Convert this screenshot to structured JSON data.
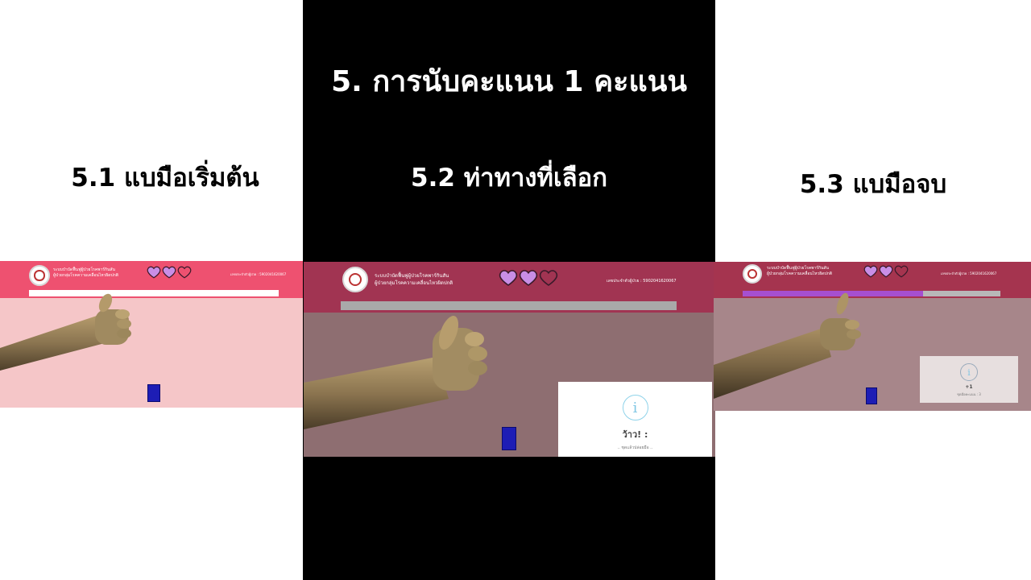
{
  "slide": {
    "title": "5. การนับคะแนน 1 คะแนน",
    "step1_label": "5.1 แบมือเริ่มต้น",
    "step2_label": "5.2 ท่าทางที่เลือก",
    "step3_label": "5.3 แบมือจบ"
  },
  "app": {
    "system_title_line1": "ระบบบำบัดฟื้นฟูผู้ป่วยโรคพาร์กินสัน",
    "system_title_line2": "ผู้ป่วยกลุ่มโรคความเคลื่อนไหวผิดปกติ",
    "patient_id": "เลขประจำตัวผู้ป่วย : 5902041620067",
    "colors": {
      "purple_heart": "#c98ee6",
      "progress": "#a64fd0",
      "target_block": "#1d1db5"
    }
  },
  "screens": {
    "shot1": {
      "hearts_filled": 2,
      "hearts_total": 3,
      "progress": 0.0
    },
    "shot2": {
      "hearts_filled": 2,
      "hearts_total": 3,
      "progress": 0.0,
      "popup": {
        "icon": "info-icon",
        "title": "ว้าว! :",
        "text": ".. ชุดแล้วปล่อยมือ .."
      }
    },
    "shot3": {
      "hearts_filled": 2,
      "hearts_total": 3,
      "progress": 0.7,
      "popup": {
        "icon": "info-icon",
        "title": "+1",
        "text": "ชุดมือคะแนน : 3"
      }
    }
  }
}
